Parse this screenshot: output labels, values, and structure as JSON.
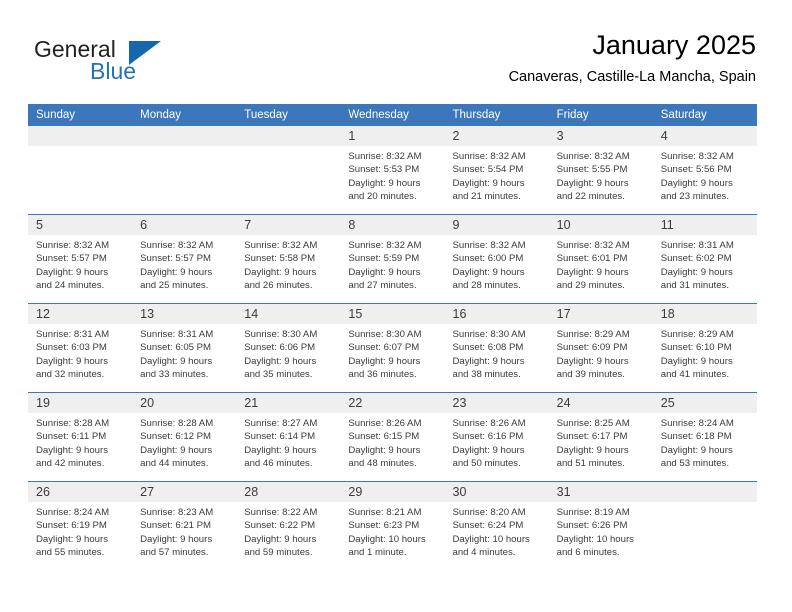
{
  "logo": {
    "word_top": "General",
    "word_bottom": "Blue",
    "accent_color": "#1667ae",
    "triangle_icon": "triangle-icon"
  },
  "header": {
    "title": "January 2025",
    "subtitle": "Canaveras, Castille-La Mancha, Spain"
  },
  "colors": {
    "header_blue": "#3b77ba",
    "row_band_gray": "#efefef",
    "text": "#3b3b3b",
    "logo_blue": "#2372b8"
  },
  "calendar": {
    "weekday_headers": [
      "Sunday",
      "Monday",
      "Tuesday",
      "Wednesday",
      "Thursday",
      "Friday",
      "Saturday"
    ],
    "weeks": [
      [
        {
          "day": "",
          "lines": []
        },
        {
          "day": "",
          "lines": []
        },
        {
          "day": "",
          "lines": []
        },
        {
          "day": "1",
          "lines": [
            "Sunrise: 8:32 AM",
            "Sunset: 5:53 PM",
            "Daylight: 9 hours",
            "and 20 minutes."
          ]
        },
        {
          "day": "2",
          "lines": [
            "Sunrise: 8:32 AM",
            "Sunset: 5:54 PM",
            "Daylight: 9 hours",
            "and 21 minutes."
          ]
        },
        {
          "day": "3",
          "lines": [
            "Sunrise: 8:32 AM",
            "Sunset: 5:55 PM",
            "Daylight: 9 hours",
            "and 22 minutes."
          ]
        },
        {
          "day": "4",
          "lines": [
            "Sunrise: 8:32 AM",
            "Sunset: 5:56 PM",
            "Daylight: 9 hours",
            "and 23 minutes."
          ]
        }
      ],
      [
        {
          "day": "5",
          "lines": [
            "Sunrise: 8:32 AM",
            "Sunset: 5:57 PM",
            "Daylight: 9 hours",
            "and 24 minutes."
          ]
        },
        {
          "day": "6",
          "lines": [
            "Sunrise: 8:32 AM",
            "Sunset: 5:57 PM",
            "Daylight: 9 hours",
            "and 25 minutes."
          ]
        },
        {
          "day": "7",
          "lines": [
            "Sunrise: 8:32 AM",
            "Sunset: 5:58 PM",
            "Daylight: 9 hours",
            "and 26 minutes."
          ]
        },
        {
          "day": "8",
          "lines": [
            "Sunrise: 8:32 AM",
            "Sunset: 5:59 PM",
            "Daylight: 9 hours",
            "and 27 minutes."
          ]
        },
        {
          "day": "9",
          "lines": [
            "Sunrise: 8:32 AM",
            "Sunset: 6:00 PM",
            "Daylight: 9 hours",
            "and 28 minutes."
          ]
        },
        {
          "day": "10",
          "lines": [
            "Sunrise: 8:32 AM",
            "Sunset: 6:01 PM",
            "Daylight: 9 hours",
            "and 29 minutes."
          ]
        },
        {
          "day": "11",
          "lines": [
            "Sunrise: 8:31 AM",
            "Sunset: 6:02 PM",
            "Daylight: 9 hours",
            "and 31 minutes."
          ]
        }
      ],
      [
        {
          "day": "12",
          "lines": [
            "Sunrise: 8:31 AM",
            "Sunset: 6:03 PM",
            "Daylight: 9 hours",
            "and 32 minutes."
          ]
        },
        {
          "day": "13",
          "lines": [
            "Sunrise: 8:31 AM",
            "Sunset: 6:05 PM",
            "Daylight: 9 hours",
            "and 33 minutes."
          ]
        },
        {
          "day": "14",
          "lines": [
            "Sunrise: 8:30 AM",
            "Sunset: 6:06 PM",
            "Daylight: 9 hours",
            "and 35 minutes."
          ]
        },
        {
          "day": "15",
          "lines": [
            "Sunrise: 8:30 AM",
            "Sunset: 6:07 PM",
            "Daylight: 9 hours",
            "and 36 minutes."
          ]
        },
        {
          "day": "16",
          "lines": [
            "Sunrise: 8:30 AM",
            "Sunset: 6:08 PM",
            "Daylight: 9 hours",
            "and 38 minutes."
          ]
        },
        {
          "day": "17",
          "lines": [
            "Sunrise: 8:29 AM",
            "Sunset: 6:09 PM",
            "Daylight: 9 hours",
            "and 39 minutes."
          ]
        },
        {
          "day": "18",
          "lines": [
            "Sunrise: 8:29 AM",
            "Sunset: 6:10 PM",
            "Daylight: 9 hours",
            "and 41 minutes."
          ]
        }
      ],
      [
        {
          "day": "19",
          "lines": [
            "Sunrise: 8:28 AM",
            "Sunset: 6:11 PM",
            "Daylight: 9 hours",
            "and 42 minutes."
          ]
        },
        {
          "day": "20",
          "lines": [
            "Sunrise: 8:28 AM",
            "Sunset: 6:12 PM",
            "Daylight: 9 hours",
            "and 44 minutes."
          ]
        },
        {
          "day": "21",
          "lines": [
            "Sunrise: 8:27 AM",
            "Sunset: 6:14 PM",
            "Daylight: 9 hours",
            "and 46 minutes."
          ]
        },
        {
          "day": "22",
          "lines": [
            "Sunrise: 8:26 AM",
            "Sunset: 6:15 PM",
            "Daylight: 9 hours",
            "and 48 minutes."
          ]
        },
        {
          "day": "23",
          "lines": [
            "Sunrise: 8:26 AM",
            "Sunset: 6:16 PM",
            "Daylight: 9 hours",
            "and 50 minutes."
          ]
        },
        {
          "day": "24",
          "lines": [
            "Sunrise: 8:25 AM",
            "Sunset: 6:17 PM",
            "Daylight: 9 hours",
            "and 51 minutes."
          ]
        },
        {
          "day": "25",
          "lines": [
            "Sunrise: 8:24 AM",
            "Sunset: 6:18 PM",
            "Daylight: 9 hours",
            "and 53 minutes."
          ]
        }
      ],
      [
        {
          "day": "26",
          "lines": [
            "Sunrise: 8:24 AM",
            "Sunset: 6:19 PM",
            "Daylight: 9 hours",
            "and 55 minutes."
          ]
        },
        {
          "day": "27",
          "lines": [
            "Sunrise: 8:23 AM",
            "Sunset: 6:21 PM",
            "Daylight: 9 hours",
            "and 57 minutes."
          ]
        },
        {
          "day": "28",
          "lines": [
            "Sunrise: 8:22 AM",
            "Sunset: 6:22 PM",
            "Daylight: 9 hours",
            "and 59 minutes."
          ]
        },
        {
          "day": "29",
          "lines": [
            "Sunrise: 8:21 AM",
            "Sunset: 6:23 PM",
            "Daylight: 10 hours",
            "and 1 minute."
          ]
        },
        {
          "day": "30",
          "lines": [
            "Sunrise: 8:20 AM",
            "Sunset: 6:24 PM",
            "Daylight: 10 hours",
            "and 4 minutes."
          ]
        },
        {
          "day": "31",
          "lines": [
            "Sunrise: 8:19 AM",
            "Sunset: 6:26 PM",
            "Daylight: 10 hours",
            "and 6 minutes."
          ]
        },
        {
          "day": "",
          "lines": []
        }
      ]
    ]
  }
}
